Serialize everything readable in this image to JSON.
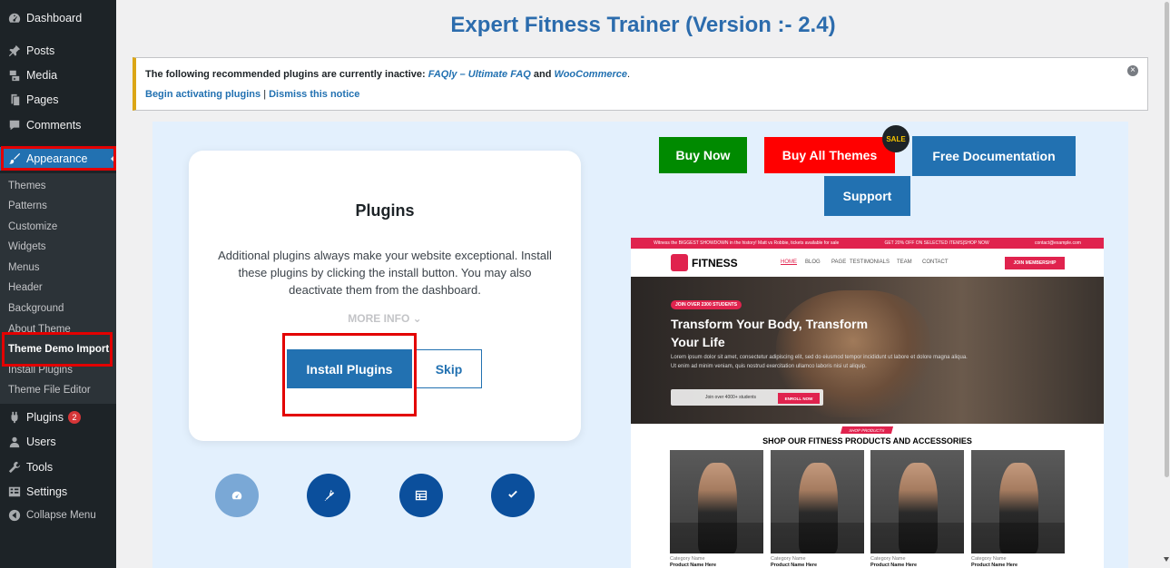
{
  "sidebar": {
    "items": [
      {
        "label": "Dashboard",
        "icon": "dashboard-icon"
      },
      {
        "label": "Posts",
        "icon": "pin-icon"
      },
      {
        "label": "Media",
        "icon": "media-icon"
      },
      {
        "label": "Pages",
        "icon": "pages-icon"
      },
      {
        "label": "Comments",
        "icon": "comment-icon"
      },
      {
        "label": "Appearance",
        "icon": "brush-icon"
      },
      {
        "label": "Plugins",
        "icon": "plug-icon",
        "badge": "2"
      },
      {
        "label": "Users",
        "icon": "user-icon"
      },
      {
        "label": "Tools",
        "icon": "wrench-icon"
      },
      {
        "label": "Settings",
        "icon": "settings-icon"
      },
      {
        "label": "Collapse Menu",
        "icon": "collapse-icon"
      }
    ],
    "submenu": [
      "Themes",
      "Patterns",
      "Customize",
      "Widgets",
      "Menus",
      "Header",
      "Background",
      "About Theme",
      "Theme Demo Import",
      "Install Plugins",
      "Theme File Editor"
    ]
  },
  "page": {
    "title": "Expert Fitness Trainer (Version :- 2.4)"
  },
  "notice": {
    "text_prefix": "The following recommended plugins are currently inactive:",
    "link1": "FAQly – Ultimate FAQ",
    "and": "and",
    "link2": "WooCommerce",
    "period": ".",
    "begin_link": "Begin activating plugins",
    "separator": "|",
    "dismiss_link": "Dismiss this notice"
  },
  "card": {
    "title": "Plugins",
    "description": "Additional plugins always make your website exceptional. Install these plugins by clicking the install button. You may also deactivate them from the dashboard.",
    "more_info": "MORE INFO",
    "install_label": "Install Plugins",
    "skip_label": "Skip"
  },
  "actions": {
    "buy_now": "Buy Now",
    "buy_all": "Buy All Themes",
    "sale_badge": "SALE",
    "free_docs": "Free Documentation",
    "support": "Support"
  },
  "preview": {
    "topbar_left": "Witness the BIGGEST SHOWDOWN in the history! Matt vs Robbie, tickets available for sale",
    "topbar_mid": "GET 20% OFF ON SELECTED ITEMS|SHOP NOW",
    "topbar_right": "contact@example.com",
    "logo": "FITNESS",
    "nav": [
      "HOME",
      "BLOG",
      "PAGE",
      "TESTIMONIALS",
      "TEAM",
      "CONTACT"
    ],
    "join_button": "JOIN MEMBERSHIP",
    "hero_badge": "JOIN OVER 2300 STUDENTS",
    "hero_title": "Transform Your Body, Transform Your Life",
    "hero_desc": "Lorem ipsum dolor sit amet, consectetur adipiscing elit, sed do eiusmod tempor incididunt ut labore et dolore magna aliqua. Ut enim ad minim veniam, quis nostrud exercitation ullamco laboris nisi ut aliquip.",
    "hero_cta": "Join over 4000+ students",
    "hero_enroll": "ENROLL NOW",
    "shop_tag": "SHOP PRODUCTS",
    "shop_title": "SHOP OUR FITNESS PRODUCTS AND ACCESSORIES",
    "product_category": "Category Name",
    "product_name": "Product Name Here"
  },
  "colors": {
    "accent": "#2271b1",
    "sidebar_bg": "#1d2327",
    "highlight_red": "#e30000",
    "buy_now_green": "#008a00",
    "buy_all_red": "#ff0000",
    "preview_pink": "#e0234e"
  }
}
